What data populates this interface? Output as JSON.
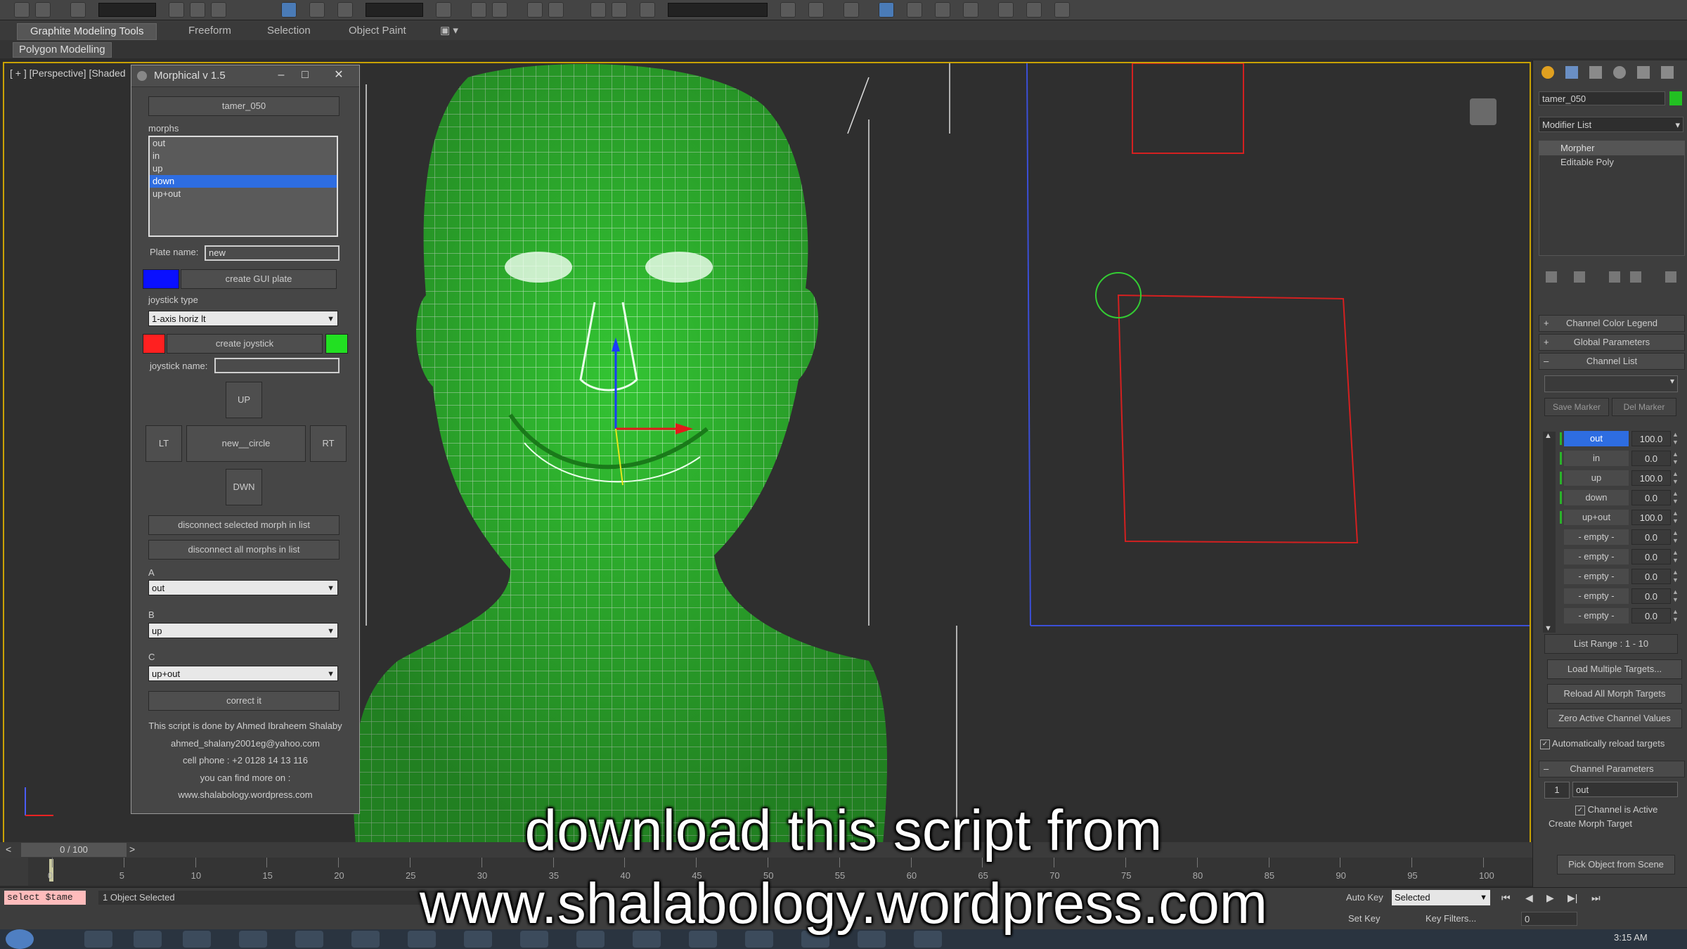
{
  "ribbon": {
    "tabs": [
      "Graphite Modeling Tools",
      "Freeform",
      "Selection",
      "Object Paint"
    ],
    "sub_tab": "Polygon Modelling"
  },
  "viewport": {
    "label": "[ + ] [Perspective] [Shaded"
  },
  "morphical": {
    "title": "Morphical v 1.5",
    "object_name": "tamer_050",
    "morphs_label": "morphs",
    "morphs": [
      "out",
      "in",
      "up",
      "down",
      "up+out"
    ],
    "selected_morph": "down",
    "plate_name_label": "Plate name:",
    "plate_name_value": "new",
    "create_gui_plate": "create GUI plate",
    "joystick_type_label": "joystick type",
    "joystick_type_value": "1-axis horiz lt",
    "create_joystick": "create joystick",
    "joystick_name_label": "joystick name:",
    "joystick_name_value": "",
    "up_button": "UP",
    "lt_button": "LT",
    "center_button": "new__circle",
    "rt_button": "RT",
    "dwn_button": "DWN",
    "disconnect_selected": "disconnect selected morph in list",
    "disconnect_all": "disconnect all morphs in list",
    "label_a": "A",
    "value_a": "out",
    "label_b": "B",
    "value_b": "up",
    "label_c": "C",
    "value_c": "up+out",
    "correct_it": "correct it",
    "credits": [
      "This script is done by  Ahmed Ibraheem Shalaby",
      "ahmed_shalany2001eg@yahoo.com",
      "cell phone : +2 0128 14 13 116",
      "you can find more on :",
      "www.shalabology.wordpress.com"
    ],
    "color_swatch_plate": "#0a10ff",
    "color_swatch_red": "#ff2020",
    "color_swatch_green": "#22e022"
  },
  "command_panel": {
    "object_name": "tamer_050",
    "modifier_list": "Modifier List",
    "stack": [
      "Morpher",
      "Editable Poly"
    ],
    "rollouts": {
      "channel_color_legend": "Channel Color Legend",
      "global_parameters": "Global Parameters",
      "channel_list": "Channel List"
    },
    "save_marker": "Save Marker",
    "del_marker": "Del Marker",
    "channels": [
      {
        "name": "out",
        "value": "100.0"
      },
      {
        "name": "in",
        "value": "0.0"
      },
      {
        "name": "up",
        "value": "100.0"
      },
      {
        "name": "down",
        "value": "0.0"
      },
      {
        "name": "up+out",
        "value": "100.0"
      },
      {
        "name": "- empty -",
        "value": "0.0"
      },
      {
        "name": "- empty -",
        "value": "0.0"
      },
      {
        "name": "- empty -",
        "value": "0.0"
      },
      {
        "name": "- empty -",
        "value": "0.0"
      },
      {
        "name": "- empty -",
        "value": "0.0"
      }
    ],
    "list_range": "List Range :   1 - 10",
    "load_multiple": "Load Multiple Targets...",
    "reload_all": "Reload All Morph Targets",
    "zero_active": "Zero Active Channel Values",
    "auto_reload": "Automatically reload targets",
    "channel_parameters": "Channel Parameters",
    "channel_index": "1",
    "channel_name": "out",
    "channel_active": "Channel is Active",
    "create_morph_target": "Create Morph Target",
    "pick_object": "Pick Object from Scene"
  },
  "timeline": {
    "frame": "0 / 100",
    "ticks": [
      "0",
      "5",
      "10",
      "15",
      "20",
      "25",
      "30",
      "35",
      "40",
      "45",
      "50",
      "55",
      "60",
      "65",
      "70",
      "75",
      "80",
      "85",
      "90",
      "95",
      "100"
    ]
  },
  "status": {
    "script": "select $tame",
    "selection": "1 Object Selected",
    "auto_key": "Auto Key",
    "selected": "Selected",
    "set_key": "Set Key",
    "key_filters": "Key Filters...",
    "frame_field": "0",
    "clock": "3:15 AM"
  },
  "caption": {
    "line1": "download this script from",
    "line2": "www.shalabology.wordpress.com"
  }
}
